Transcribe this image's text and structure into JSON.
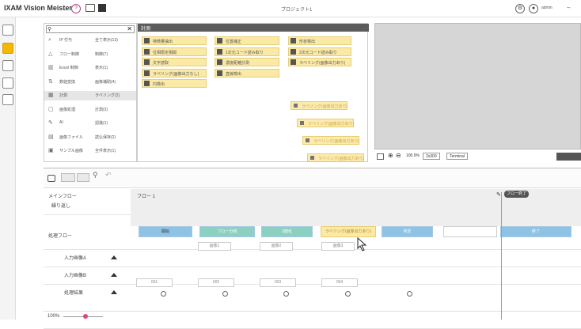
{
  "app": {
    "title": "IXAM Vision Meister",
    "project": "プロジェクト1",
    "user": "admin"
  },
  "categories": [
    {
      "icon": "⌕",
      "c1": "IP 付与",
      "c2": "全て表示(13)"
    },
    {
      "icon": "△",
      "c1": "フロー制御",
      "c2": "制御(7)"
    },
    {
      "icon": "▥",
      "c1": "Excel 制御",
      "c2": "表示(1)"
    },
    {
      "icon": "⇅",
      "c1": "数値変換",
      "c2": "画像補助(4)"
    },
    {
      "icon": "▦",
      "c1": "計測",
      "c2": "ラベリング(2)"
    },
    {
      "icon": "▢",
      "c1": "画像処理",
      "c2": "計測(3)"
    },
    {
      "icon": "✎",
      "c1": "AI",
      "c2": "認識(1)"
    },
    {
      "icon": "▤",
      "c1": "画像ファイル",
      "c2": "読込保存(2)"
    },
    {
      "icon": "▣",
      "c1": "サンプル画像",
      "c2": "全件表示(1)"
    }
  ],
  "tools_header": "計測",
  "tools": [
    {
      "label": "特徴量抽出"
    },
    {
      "label": "位置補正"
    },
    {
      "label": "形状検出"
    },
    {
      "label": "位相限定相関"
    },
    {
      "label": "1次元コード読み取り"
    },
    {
      "label": "2次元コード読み取り"
    },
    {
      "label": "文字読取"
    },
    {
      "label": "濃度距離計測"
    },
    {
      "label": "ラベリング(画像出力あり)"
    },
    {
      "label": "ラベリング(画像出力なし)"
    },
    {
      "label": "直線検出"
    },
    {
      "label": "円検出"
    }
  ],
  "ghost_label": "ラベリング(画像出力あり)",
  "preview_toolbar": {
    "zoom": "100.0%",
    "size": "2x300",
    "mode": "Terminal"
  },
  "flow": {
    "main_flow": "メインフロー",
    "repeat": "繰り返し",
    "process_flow": "処理フロー",
    "flow_name": "フロー 1",
    "end_label": "フロー終了",
    "rows": [
      "入力画像A",
      "入力画像B",
      "処理結果"
    ],
    "nodes": [
      "開始",
      "フロー分岐",
      "2値化",
      "ラベリング(画像出力あり)",
      "判定",
      "",
      "終了"
    ],
    "subs": [
      "画像1",
      "画像2",
      "画像3"
    ],
    "outputs": [
      "001",
      "002",
      "003",
      "004"
    ],
    "zoom_label": "100%"
  },
  "colors": {
    "accent": "#f5b800",
    "tool_bg": "#fbe9a6",
    "node_blue": "#8ec3e6",
    "node_green": "#8bd0c2",
    "end_line": "#7ac143"
  }
}
